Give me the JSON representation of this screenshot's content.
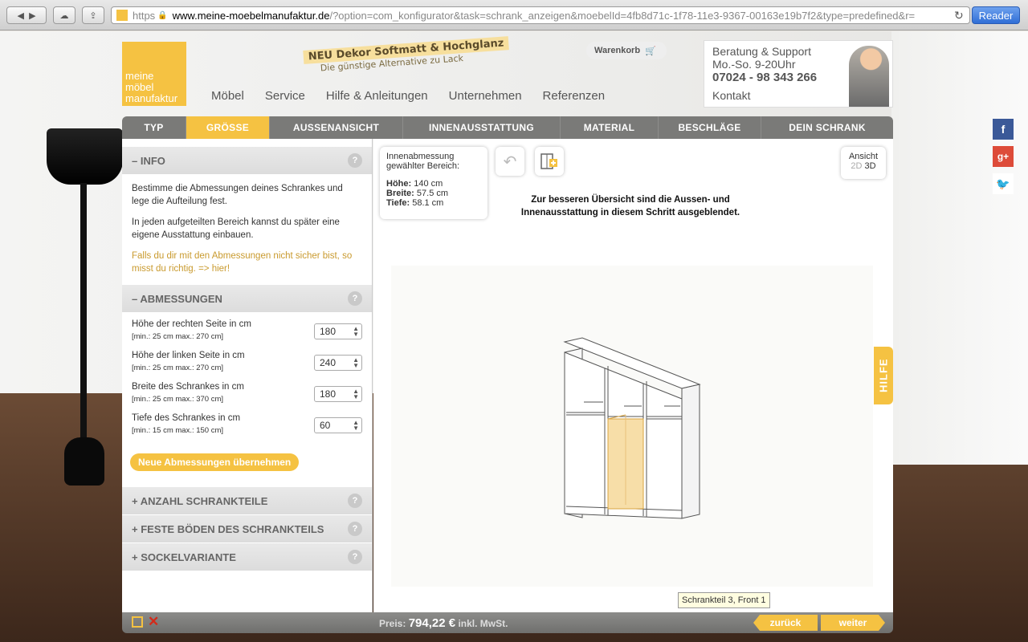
{
  "browser": {
    "url_scheme": "https",
    "url_domain": "www.meine-moebelmanufaktur.de",
    "url_path": "/?option=com_konfigurator&task=schrank_anzeigen&moebelId=4fb8d71c-1f78-11e3-9367-00163e19b7f2&type=predefined&r=",
    "reader_label": "Reader"
  },
  "header": {
    "logo_lines": [
      "meine",
      "möbel",
      "manufaktur"
    ],
    "promo_title": "NEU Dekor Softmatt & Hochglanz",
    "promo_subtitle": "Die günstige Alternative zu Lack",
    "cart_label": "Warenkorb",
    "nav": [
      "Möbel",
      "Service",
      "Hilfe & Anleitungen",
      "Unternehmen",
      "Referenzen"
    ],
    "support": {
      "line1": "Beratung & Support",
      "line2": "Mo.-So.  9-20Uhr",
      "phone": "07024 - 98 343 266",
      "contact": "Kontakt"
    }
  },
  "steps": [
    {
      "label": "TYP",
      "active": false
    },
    {
      "label": "GRÖSSE",
      "active": true
    },
    {
      "label": "AUSSENANSICHT",
      "active": false
    },
    {
      "label": "INNENAUSSTATTUNG",
      "active": false
    },
    {
      "label": "MATERIAL",
      "active": false
    },
    {
      "label": "BESCHLÄGE",
      "active": false
    },
    {
      "label": "DEIN SCHRANK",
      "active": false
    }
  ],
  "left": {
    "info_title": "– INFO",
    "info_p1": "Bestimme die Abmessungen deines Schrankes und lege die Aufteilung fest.",
    "info_p2": "In jeden aufgeteilten Bereich kannst du später eine eigene Ausstattung einbauen.",
    "info_hint": "Falls du dir mit den Abmessungen nicht sicher bist, so misst du richtig. => hier!",
    "dims_title": "– ABMESSUNGEN",
    "dims": [
      {
        "label": "Höhe der rechten Seite in cm",
        "range": "[min.: 25 cm max.: 270 cm]",
        "value": "180"
      },
      {
        "label": "Höhe der linken Seite in cm",
        "range": "[min.: 25 cm max.: 270 cm]",
        "value": "240"
      },
      {
        "label": "Breite des Schrankes in cm",
        "range": "[min.: 25 cm max.: 370 cm]",
        "value": "180"
      },
      {
        "label": "Tiefe des Schrankes in cm",
        "range": "[min.: 15 cm max.: 150 cm]",
        "value": "60"
      }
    ],
    "apply_label": "Neue Abmessungen übernehmen",
    "collapsed": [
      "+ ANZAHL SCHRANKTEILE",
      "+ FESTE BÖDEN DES SCHRANKTEILS",
      "+ SOCKELVARIANTE"
    ],
    "help_glyph": "?"
  },
  "main": {
    "dimbox_title": "Innenabmessung gewählter Bereich:",
    "height_label": "Höhe:",
    "height_value": "140 cm",
    "width_label": "Breite:",
    "width_value": "57.5 cm",
    "depth_label": "Tiefe:",
    "depth_value": "58.1 cm",
    "notice": "Zur besseren Übersicht sind die Aussen- und Innenausstattung in diesem Schritt ausgeblendet.",
    "view_label": "Ansicht",
    "view_2d": "2D",
    "view_3d": "3D",
    "tooltip": "Schrankteil 3, Front 1",
    "hilfe": "HILFE"
  },
  "footer": {
    "price_label": "Preis:",
    "price_value": "794,22 €",
    "price_suffix": "inkl. MwSt.",
    "back_label": "zurück",
    "next_label": "weiter"
  },
  "colors": {
    "accent": "#f5c242",
    "tabbar": "#7a7a78",
    "facebook": "#3b5998",
    "googleplus": "#dd4b39",
    "twitter": "#1da1f2"
  }
}
